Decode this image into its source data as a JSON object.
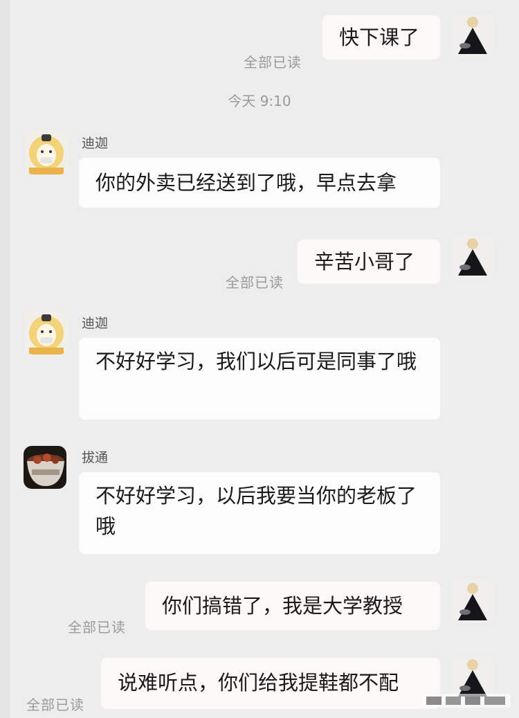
{
  "messages": [
    {
      "side": "me",
      "text": "快下课了",
      "read": "全部已读"
    },
    {
      "side": "system",
      "time": "今天 9:10"
    },
    {
      "side": "them",
      "sender": "迪迦",
      "avatar": "ultraman-face-avatar",
      "text": "你的外卖已经送到了哦，早点去拿"
    },
    {
      "side": "me",
      "text": "辛苦小哥了",
      "read": "全部已读"
    },
    {
      "side": "them",
      "sender": "迪迦",
      "avatar": "ultraman-face-avatar",
      "text": "不好好学习，我们以后可是同事了哦"
    },
    {
      "side": "them",
      "sender": "拔通",
      "avatar": "food-bowl-avatar",
      "text": "不好好学习，以后我要当你的老板了哦"
    },
    {
      "side": "me",
      "text": "你们搞错了，我是大学教授",
      "read": "全部已读"
    },
    {
      "side": "me",
      "text": "说难听点，你们给我提鞋都不配",
      "read": "全部已读"
    }
  ],
  "colors": {
    "background": "#ededed",
    "bubble": "#fdfcfc",
    "meta": "#9a9a9a"
  },
  "watermark_icon": "watermark-icon"
}
